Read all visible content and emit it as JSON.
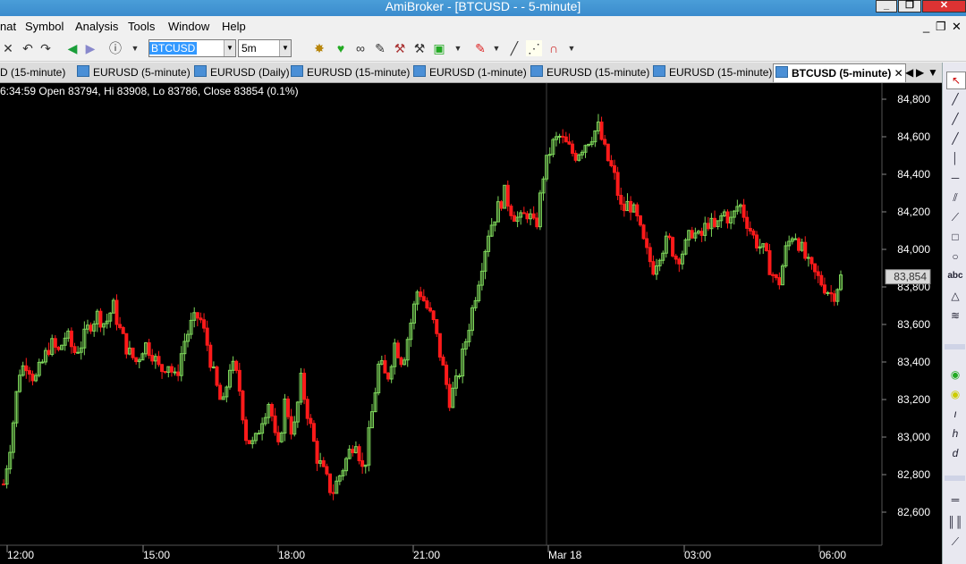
{
  "window": {
    "title": "AmiBroker - [BTCUSD -  - 5-minute]"
  },
  "menu": [
    "nat",
    "Symbol",
    "Analysis",
    "Tools",
    "Window",
    "Help"
  ],
  "toolbar": {
    "symbol_value": "BTCUSD",
    "interval_value": "5m"
  },
  "tabs": [
    {
      "label": "D (15-minute)"
    },
    {
      "label": "EURUSD (5-minute)"
    },
    {
      "label": "EURUSD (Daily)"
    },
    {
      "label": "EURUSD (15-minute)"
    },
    {
      "label": "EURUSD (1-minute)"
    },
    {
      "label": "EURUSD (15-minute)"
    },
    {
      "label": "EURUSD (15-minute)"
    },
    {
      "label": "BTCUSD (5-minute)",
      "active": true
    }
  ],
  "chart": {
    "info_line": "6:34:59 Open 83794, Hi 83908, Lo 83786, Close 83854 (0.1%)",
    "last_price_label": "83,854",
    "colors": {
      "up": "#7dd65a",
      "down": "#ff1a1a",
      "background": "#000000",
      "axis_text": "#ffffff"
    }
  },
  "chart_data": {
    "type": "candlestick",
    "ylim": [
      82500,
      84850
    ],
    "y_ticks": [
      "84,800",
      "84,600",
      "84,400",
      "84,200",
      "84,000",
      "83,800",
      "83,600",
      "83,400",
      "83,200",
      "83,000",
      "82,800",
      "82,600"
    ],
    "x_ticks": [
      "12:00",
      "15:00",
      "18:00",
      "21:00",
      "Mar 18",
      "03:00",
      "06:00"
    ],
    "last_close": 83854,
    "close_path": [
      82750,
      83000,
      83350,
      83400,
      83300,
      83400,
      83500,
      83450,
      83550,
      83450,
      83500,
      83600,
      83650,
      83600,
      83700,
      83550,
      83450,
      83400,
      83500,
      83450,
      83350,
      83400,
      83300,
      83500,
      83600,
      83650,
      83500,
      83300,
      83150,
      83400,
      83300,
      83000,
      82950,
      83100,
      83200,
      82900,
      83200,
      83000,
      83300,
      83100,
      82900,
      82800,
      82700,
      82800,
      82900,
      83000,
      82800,
      83100,
      83400,
      83300,
      83500,
      83400,
      83600,
      83800,
      83700,
      83600,
      83400,
      83200,
      83300,
      83500,
      83700,
      83900,
      84100,
      84200,
      84300,
      84200,
      84150,
      84200,
      84100,
      84400,
      84550,
      84600,
      84550,
      84500,
      84550,
      84600,
      84650,
      84500,
      84400,
      84200,
      84250,
      84150,
      84000,
      83900,
      84000,
      84050,
      83950,
      84000,
      84100,
      84050,
      84150,
      84100,
      84200,
      84150,
      84250,
      84150,
      84050,
      84000,
      83900,
      83800,
      84000,
      84100,
      84000,
      83900,
      83850,
      83800,
      83750,
      83850
    ]
  }
}
